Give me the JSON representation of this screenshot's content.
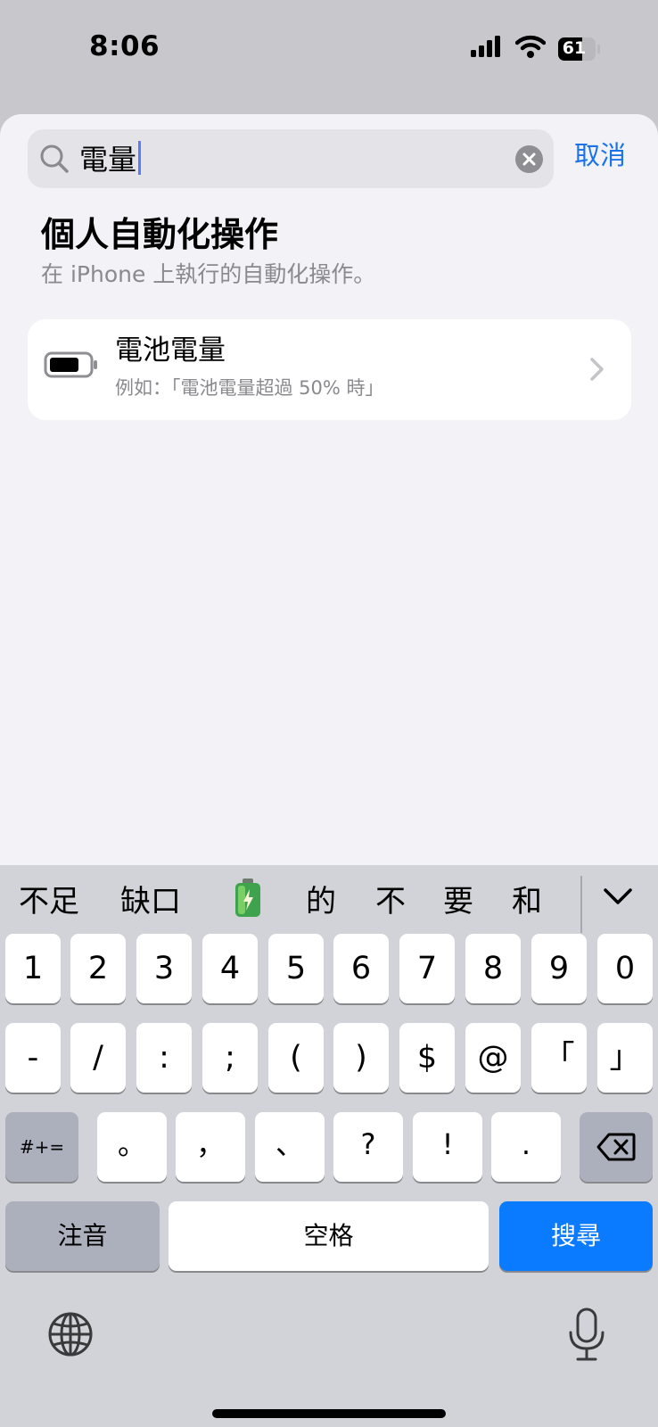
{
  "status_bar": {
    "time": "8:06",
    "battery": "61"
  },
  "search": {
    "query": "電量",
    "cancel_label": "取消"
  },
  "section": {
    "title": "個人自動化操作",
    "subtitle": "在 iPhone 上執行的自動化操作。"
  },
  "results": [
    {
      "title": "電池電量",
      "description": "例如：「電池電量超過 50% 時」",
      "icon": "battery-icon"
    }
  ],
  "keyboard": {
    "candidates": [
      "不足",
      "缺口",
      "🔋",
      "的",
      "不",
      "要",
      "和"
    ],
    "row1": [
      "1",
      "2",
      "3",
      "4",
      "5",
      "6",
      "7",
      "8",
      "9",
      "0"
    ],
    "row2": [
      "-",
      "/",
      ":",
      ";",
      "(",
      ")",
      "$",
      "@",
      "「",
      "」"
    ],
    "row3_modifier": "#+=",
    "row3": [
      "。",
      "，",
      "、",
      "?",
      "!",
      "."
    ],
    "mode_label": "注音",
    "space_label": "空格",
    "search_label": "搜尋"
  },
  "colors": {
    "accent": "#0a7aff",
    "link": "#1a73e8",
    "battery_green": "#34c759"
  }
}
